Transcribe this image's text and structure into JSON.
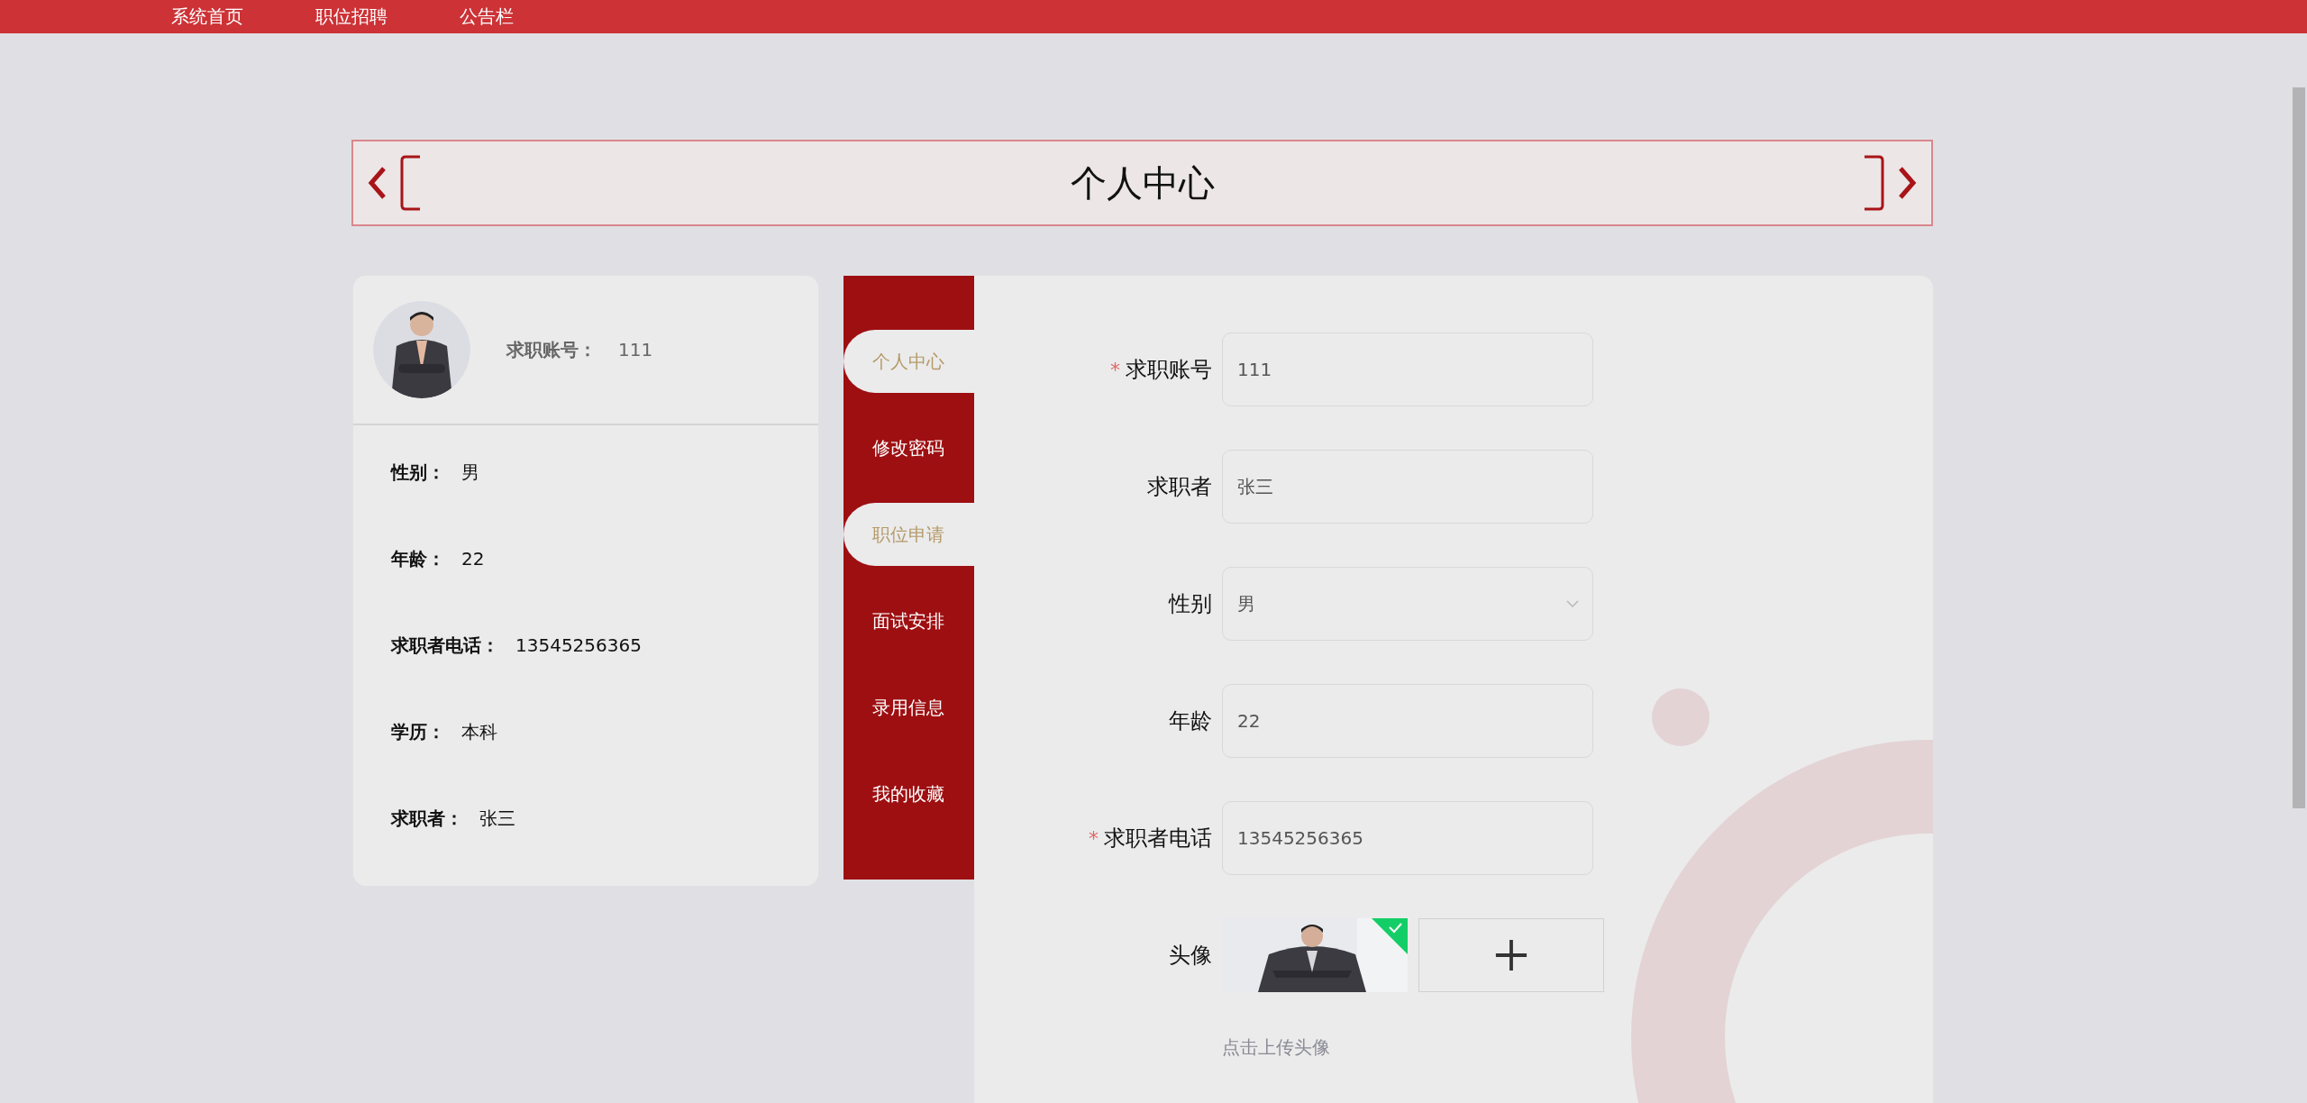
{
  "nav": {
    "items": [
      {
        "label": "系统首页"
      },
      {
        "label": "职位招聘"
      },
      {
        "label": "公告栏"
      }
    ]
  },
  "banner": {
    "title": "个人中心"
  },
  "profile": {
    "account_label": "求职账号：",
    "account": "111",
    "fields": [
      {
        "label": "性别：",
        "value": "男"
      },
      {
        "label": "年龄：",
        "value": "22"
      },
      {
        "label": "求职者电话：",
        "value": "13545256365"
      },
      {
        "label": "学历：",
        "value": "本科"
      },
      {
        "label": "求职者：",
        "value": "张三"
      }
    ]
  },
  "menu": {
    "items": [
      {
        "label": "个人中心",
        "selected": true
      },
      {
        "label": "修改密码",
        "selected": false
      },
      {
        "label": "职位申请",
        "selected": true
      },
      {
        "label": "面试安排",
        "selected": false
      },
      {
        "label": "录用信息",
        "selected": false
      },
      {
        "label": "我的收藏",
        "selected": false
      }
    ]
  },
  "form": {
    "fields": [
      {
        "kind": "input",
        "label": "求职账号",
        "mark": "*",
        "value": "111"
      },
      {
        "kind": "input",
        "label": "求职者",
        "value": "张三"
      },
      {
        "kind": "select",
        "label": "性别",
        "value": "男"
      },
      {
        "kind": "input",
        "label": "年龄",
        "value": "22"
      },
      {
        "kind": "input",
        "label": "求职者电话",
        "mark": "*",
        "value": "13545256365"
      }
    ],
    "avatar": {
      "label": "头像",
      "uploaded": true
    },
    "upload_hint": "点击上传头像"
  }
}
